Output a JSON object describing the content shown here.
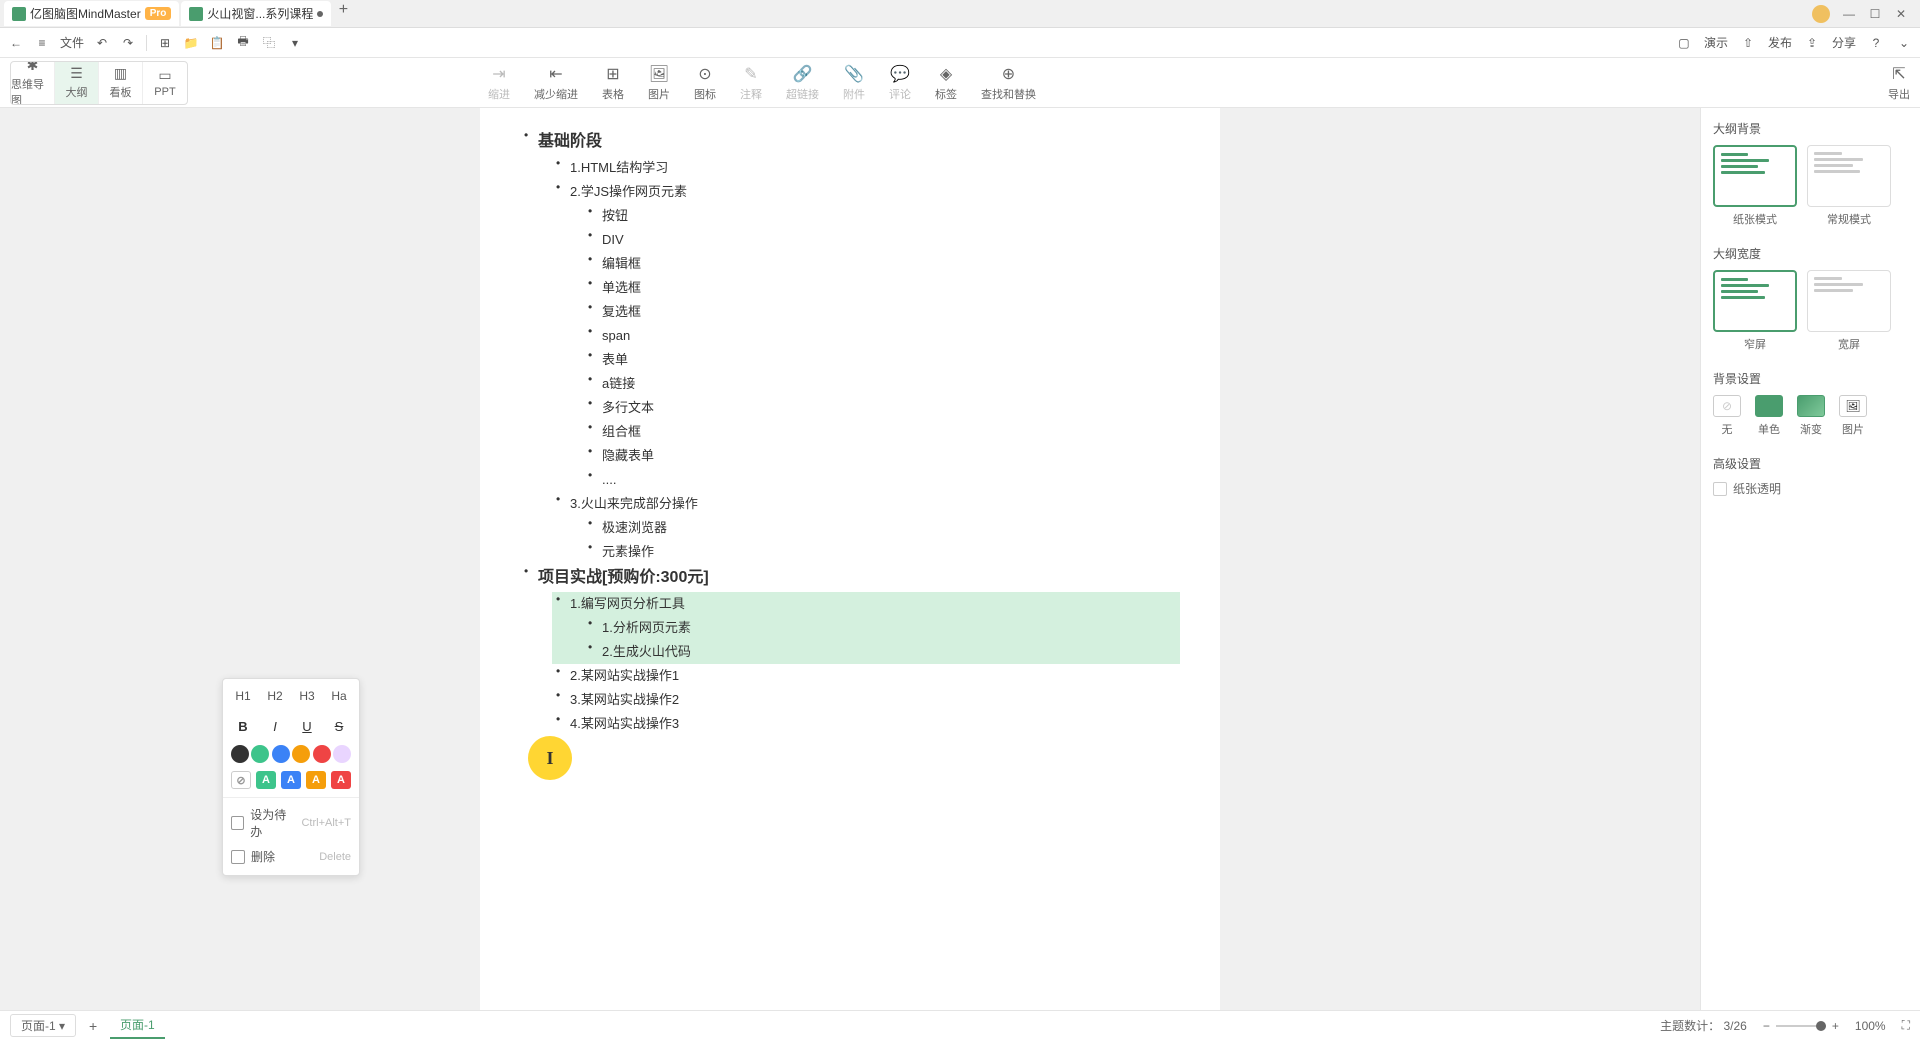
{
  "titlebar": {
    "tab1": {
      "name": "亿图脑图MindMaster",
      "badge": "Pro"
    },
    "tab2": {
      "name": "火山视窗...系列课程"
    }
  },
  "menubar": {
    "file": "文件",
    "present": "演示",
    "publish": "发布",
    "share": "分享"
  },
  "toolbar": {
    "views": {
      "mindmap": "思维导图",
      "outline": "大纲",
      "kanban": "看板",
      "ppt": "PPT"
    },
    "tools": {
      "indent": "缩进",
      "outdent": "减少缩进",
      "table": "表格",
      "image": "图片",
      "icon": "图标",
      "note": "注释",
      "hyperlink": "超链接",
      "attachment": "附件",
      "comment": "评论",
      "tag": "标签",
      "find": "查找和替换"
    },
    "export": "导出"
  },
  "outline": {
    "h1a": "基础阶段",
    "l2_1": "1.HTML结构学习",
    "l2_2": "2.学JS操作网页元素",
    "l3_1": "按钮",
    "l3_2": "DIV",
    "l3_3": "编辑框",
    "l3_4": "单选框",
    "l3_5": "复选框",
    "l3_6": "span",
    "l3_7": "表单",
    "l3_8": "a链接",
    "l3_9": "多行文本",
    "l3_10": "组合框",
    "l3_11": "隐藏表单",
    "l3_12": "....",
    "l2_3": "3.火山来完成部分操作",
    "l3_13": "极速浏览器",
    "l3_14": "元素操作",
    "h1b": "项目实战[预购价:300元]",
    "l2_4": "1.编写网页分析工具",
    "l3_15": "1.分析网页元素",
    "l3_16": "2.生成火山代码",
    "l2_5": "2.某网站实战操作1",
    "l2_6": "3.某网站实战操作2",
    "l2_7": "4.某网站实战操作3"
  },
  "context": {
    "h1": "H1",
    "h2": "H2",
    "h3": "H3",
    "ha": "Ha",
    "bold": "B",
    "italic": "I",
    "underline": "U",
    "strike": "S",
    "colors": [
      "#333333",
      "#3dc48b",
      "#3b82f6",
      "#f59e0b",
      "#ef4444",
      "#e9d5ff"
    ],
    "bgs": [
      {
        "bg": "#ffffff",
        "fg": "#999999",
        "border": "#cccccc",
        "label": "A"
      },
      {
        "bg": "#3dc48b",
        "fg": "#ffffff",
        "border": "#3dc48b",
        "label": "A"
      },
      {
        "bg": "#3b82f6",
        "fg": "#ffffff",
        "border": "#3b82f6",
        "label": "A"
      },
      {
        "bg": "#f59e0b",
        "fg": "#ffffff",
        "border": "#f59e0b",
        "label": "A"
      },
      {
        "bg": "#ef4444",
        "fg": "#ffffff",
        "border": "#ef4444",
        "label": "A"
      }
    ],
    "todo": "设为待办",
    "todo_sc": "Ctrl+Alt+T",
    "delete": "删除",
    "delete_sc": "Delete"
  },
  "panel": {
    "bg_title": "大纲背景",
    "bg_paper": "纸张模式",
    "bg_normal": "常规模式",
    "width_title": "大纲宽度",
    "width_narrow": "窄屏",
    "width_wide": "宽屏",
    "bgset_title": "背景设置",
    "bg_none": "无",
    "bg_solid": "单色",
    "bg_gradient": "渐变",
    "bg_image": "图片",
    "adv_title": "高级设置",
    "transparent": "纸张透明"
  },
  "status": {
    "page_label": "页面-1",
    "page_tab": "页面-1",
    "topic_count": "主题数计：",
    "topic_val": "3/26",
    "zoom": "100%"
  }
}
